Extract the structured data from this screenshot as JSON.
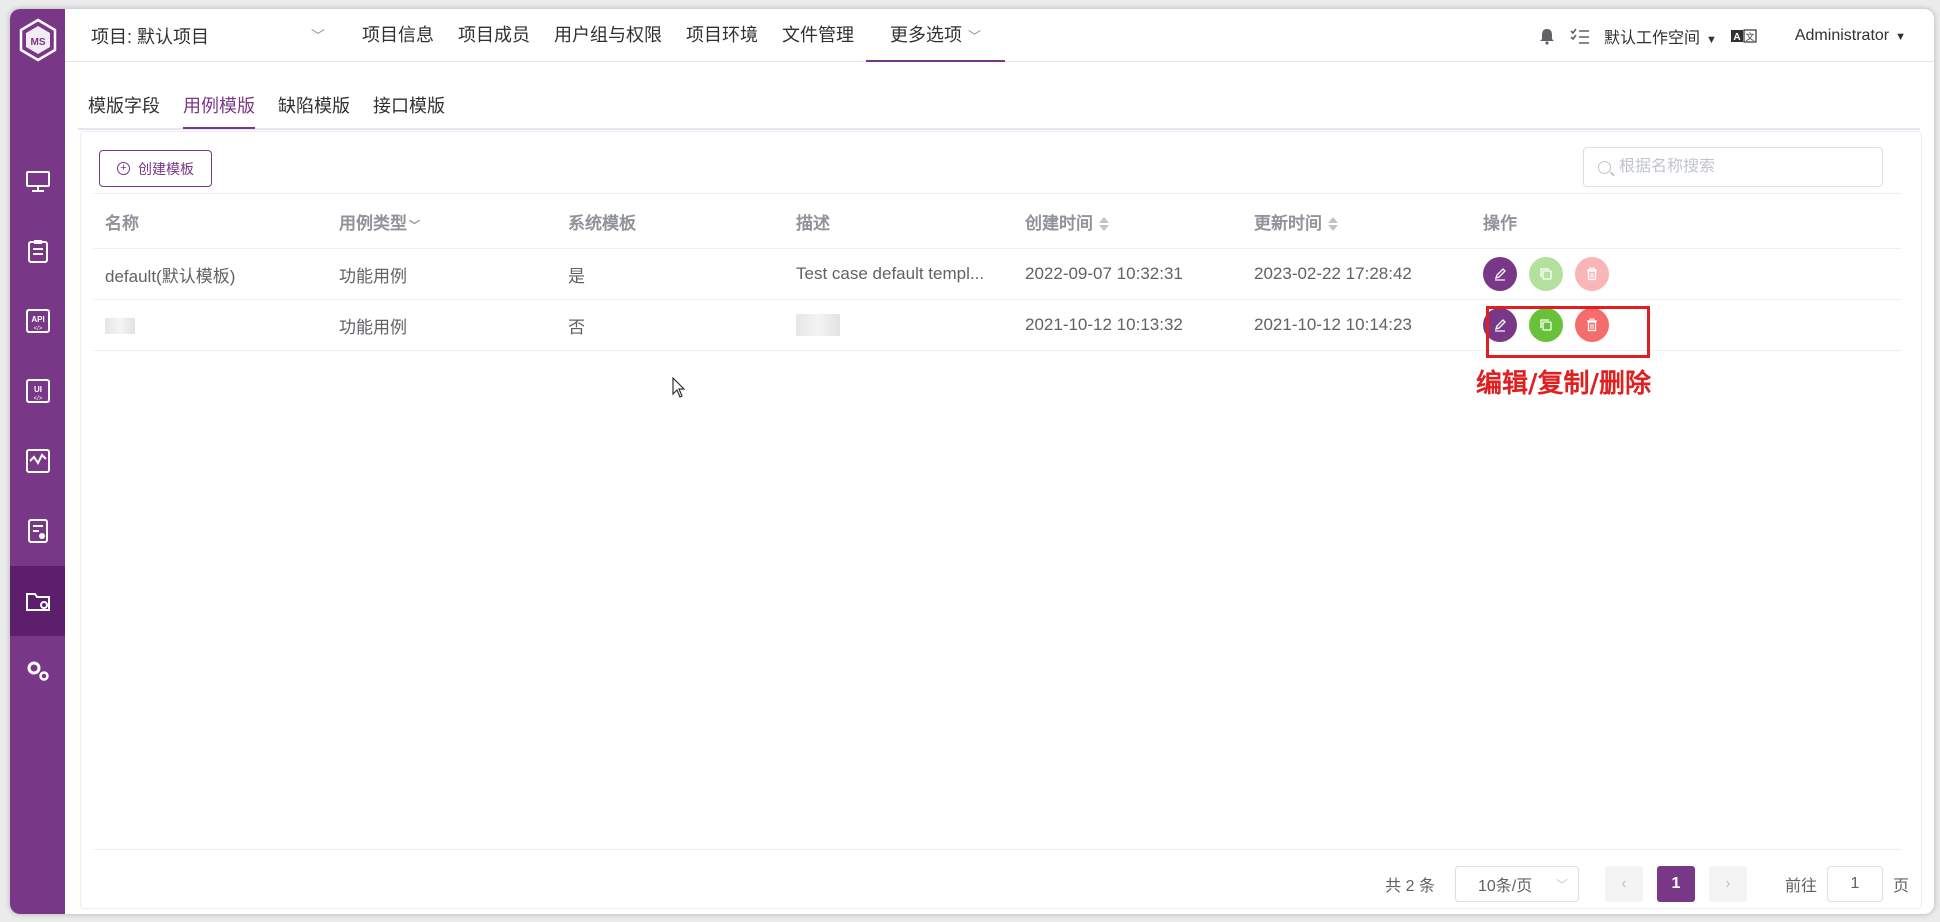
{
  "header": {
    "project_label": "项目: 默认项目",
    "nav": [
      "项目信息",
      "项目成员",
      "用户组与权限",
      "项目环境",
      "文件管理"
    ],
    "more_label": "更多选项",
    "workspace": "默认工作空间",
    "user": "Administrator"
  },
  "tabs": [
    "模版字段",
    "用例模版",
    "缺陷模版",
    "接口模版"
  ],
  "active_tab": "用例模版",
  "toolbar": {
    "create_label": "创建模板",
    "search_placeholder": "根据名称搜索"
  },
  "table": {
    "columns": [
      "名称",
      "用例类型",
      "系统模板",
      "描述",
      "创建时间",
      "更新时间",
      "操作"
    ],
    "rows": [
      {
        "name": "default(默认模板)",
        "type": "功能用例",
        "system": "是",
        "desc": "Test case default templ...",
        "created": "2022-09-07 10:32:31",
        "updated": "2023-02-22 17:28:42"
      },
      {
        "name": "",
        "type": "功能用例",
        "system": "否",
        "desc": "",
        "created": "2021-10-12 10:13:32",
        "updated": "2021-10-12 10:14:23"
      }
    ]
  },
  "annotation": "编辑/复制/删除",
  "pagination": {
    "total": "共 2 条",
    "page_size": "10条/页",
    "current_page": "1",
    "goto_label": "前往",
    "goto_value": "1",
    "page_unit": "页"
  },
  "colors": {
    "primary": "#783887",
    "success": "#67c23a",
    "danger": "#f56c6c",
    "annotation": "#e02020"
  }
}
